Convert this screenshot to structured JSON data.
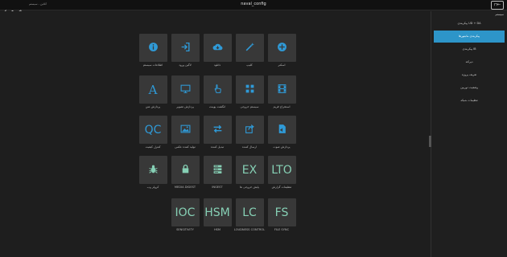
{
  "topbar": {
    "title": "naval_config",
    "status": "آنلاین - سیستم"
  },
  "sidebar": {
    "header": "سیستم",
    "items": [
      {
        "label": "پیکربندی UD + DA",
        "active": false
      },
      {
        "label": "پیکربندی مانیتورها",
        "active": true
      },
      {
        "label": "پیکربندی IB",
        "active": false
      },
      {
        "label": "دیرکتد",
        "active": false
      },
      {
        "label": "تعریف پروژه",
        "active": false
      },
      {
        "label": "وضعیت دوربین",
        "active": false
      },
      {
        "label": "تنظیمات شبکه",
        "active": false
      }
    ]
  },
  "tiles": [
    {
      "label": "اطلاعات سیستم",
      "icon": "info-icon",
      "color": "#2f9ad7"
    },
    {
      "label": "لاگین ورود",
      "icon": "login-icon",
      "color": "#2f9ad7"
    },
    {
      "label": "دانلود",
      "icon": "cloud-download-icon",
      "color": "#2f9ad7"
    },
    {
      "label": "کلیپ",
      "icon": "magic-wand-icon",
      "color": "#2f9ad7"
    },
    {
      "label": "اسکنر",
      "icon": "plus-circle-icon",
      "color": "#2f9ad7"
    },
    {
      "label": "پردازش متن",
      "icon": "font-icon",
      "color": "#2f9ad7"
    },
    {
      "label": "پردازش تصویر",
      "icon": "monitor-icon",
      "color": "#2f9ad7"
    },
    {
      "label": "انگشت پوینت",
      "icon": "hand-pointer-icon",
      "color": "#2f9ad7"
    },
    {
      "label": "سیستم خروجی",
      "icon": "panel-icon",
      "color": "#2f9ad7"
    },
    {
      "label": "استخراج فریم",
      "icon": "film-icon",
      "color": "#2f9ad7"
    },
    {
      "label": "کنترل کیفیت",
      "text": "QC",
      "color": "#2f9ad7"
    },
    {
      "label": "تولید کننده عکس",
      "icon": "image-icon",
      "color": "#2f9ad7"
    },
    {
      "label": "تبدیل کننده",
      "icon": "exchange-icon",
      "color": "#2f9ad7"
    },
    {
      "label": "ارسال کننده",
      "icon": "share-icon",
      "color": "#2f9ad7"
    },
    {
      "label": "پردازش صوت",
      "icon": "audio-file-icon",
      "color": "#2f9ad7"
    },
    {
      "label": "کرولر وب",
      "icon": "bug-icon",
      "color": "#86d0b5"
    },
    {
      "label": "MEDIA DIGEST",
      "icon": "lock-icon",
      "color": "#86d0b5"
    },
    {
      "label": "INGEST",
      "icon": "server-icon",
      "color": "#86d0b5"
    },
    {
      "label": "پایش خروجی ها",
      "text": "EX",
      "color": "#86d0b5"
    },
    {
      "label": "تنظیمات گزارش",
      "text": "LTO",
      "color": "#86d0b5"
    },
    {
      "label": "SENSITIVITY",
      "text": "IOC",
      "color": "#86d0b5"
    },
    {
      "label": "HSM",
      "text": "HSM",
      "color": "#86d0b5"
    },
    {
      "label": "LOUDNESS CONTROL",
      "text": "LC",
      "color": "#86d0b5"
    },
    {
      "label": "FILE SYNC",
      "text": "FS",
      "color": "#86d0b5"
    }
  ]
}
